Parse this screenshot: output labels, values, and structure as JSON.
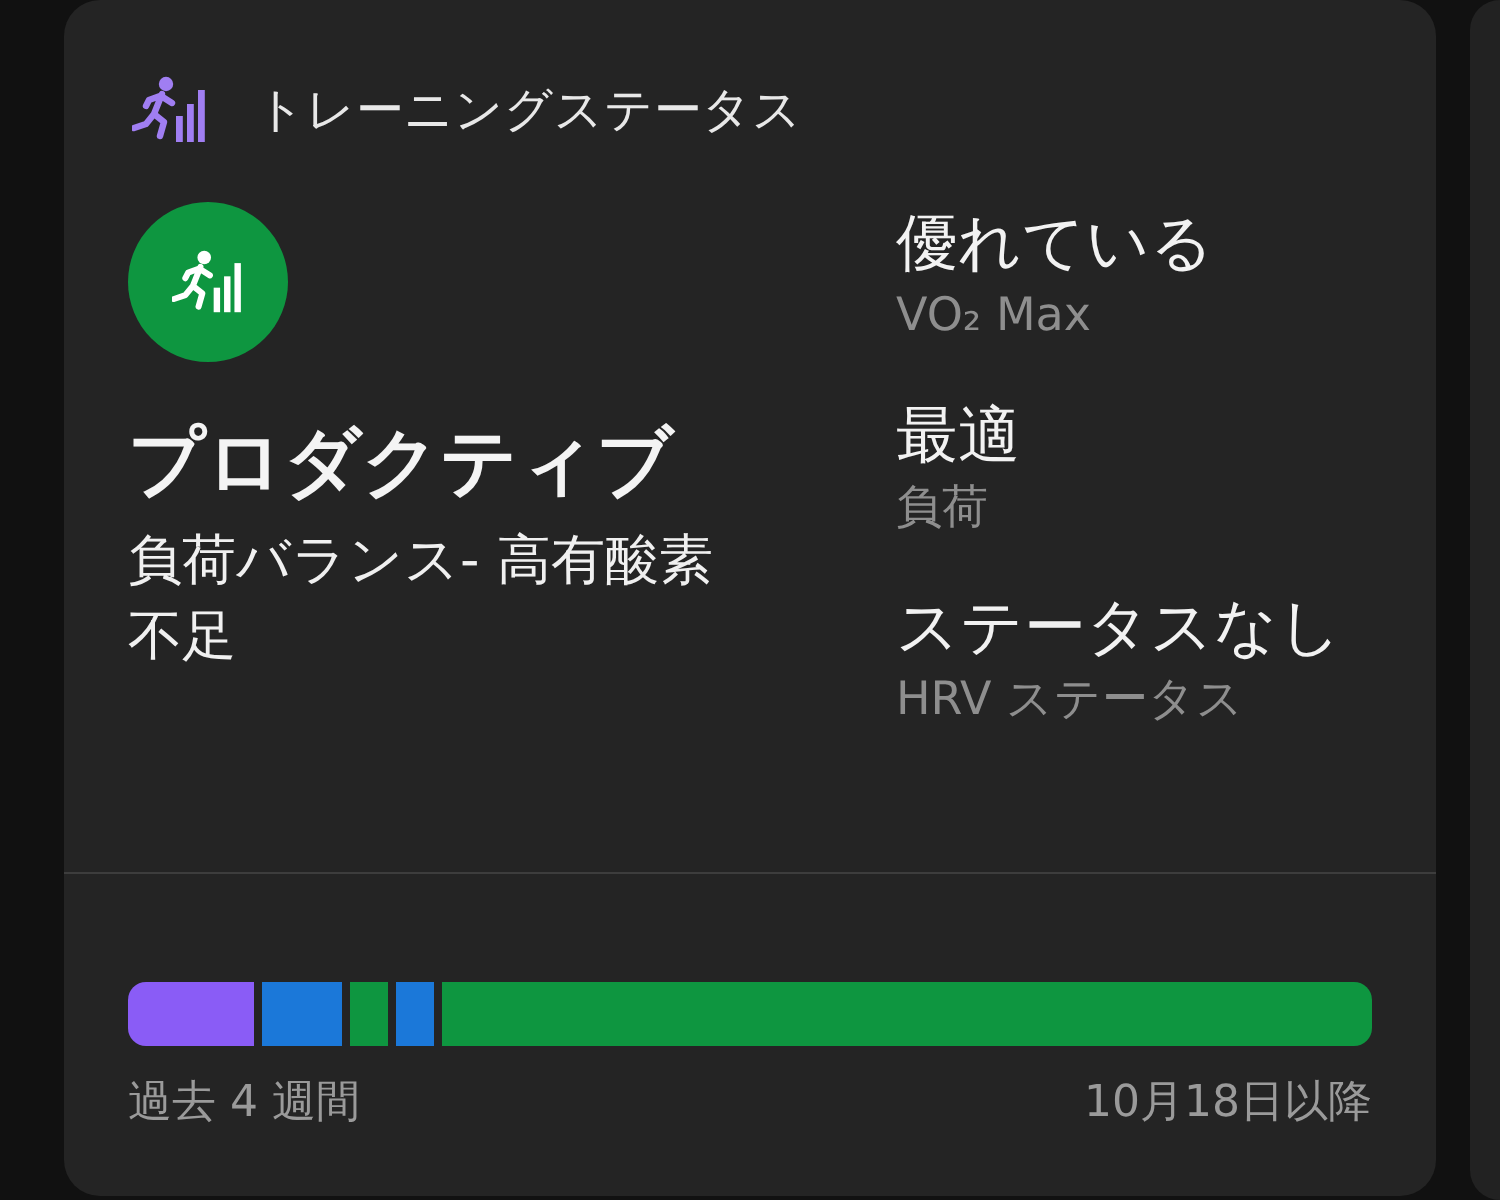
{
  "header": {
    "title": "トレーニングステータス"
  },
  "status": {
    "title": "プロダクティブ",
    "description": "負荷バランス- 高有酸素不足"
  },
  "metrics": [
    {
      "value": "優れている",
      "label": "VO₂ Max"
    },
    {
      "value": "最適",
      "label": "負荷"
    },
    {
      "value": "ステータスなし",
      "label": "HRV ステータス"
    }
  ],
  "history": {
    "segments": [
      {
        "color": "#8a5cf6"
      },
      {
        "color": "#1b78d9"
      },
      {
        "color": "#0e9640"
      },
      {
        "color": "#1b78d9"
      },
      {
        "color": "#0e9640"
      }
    ],
    "period": "過去 4 週間",
    "since": "10月18日以降"
  }
}
